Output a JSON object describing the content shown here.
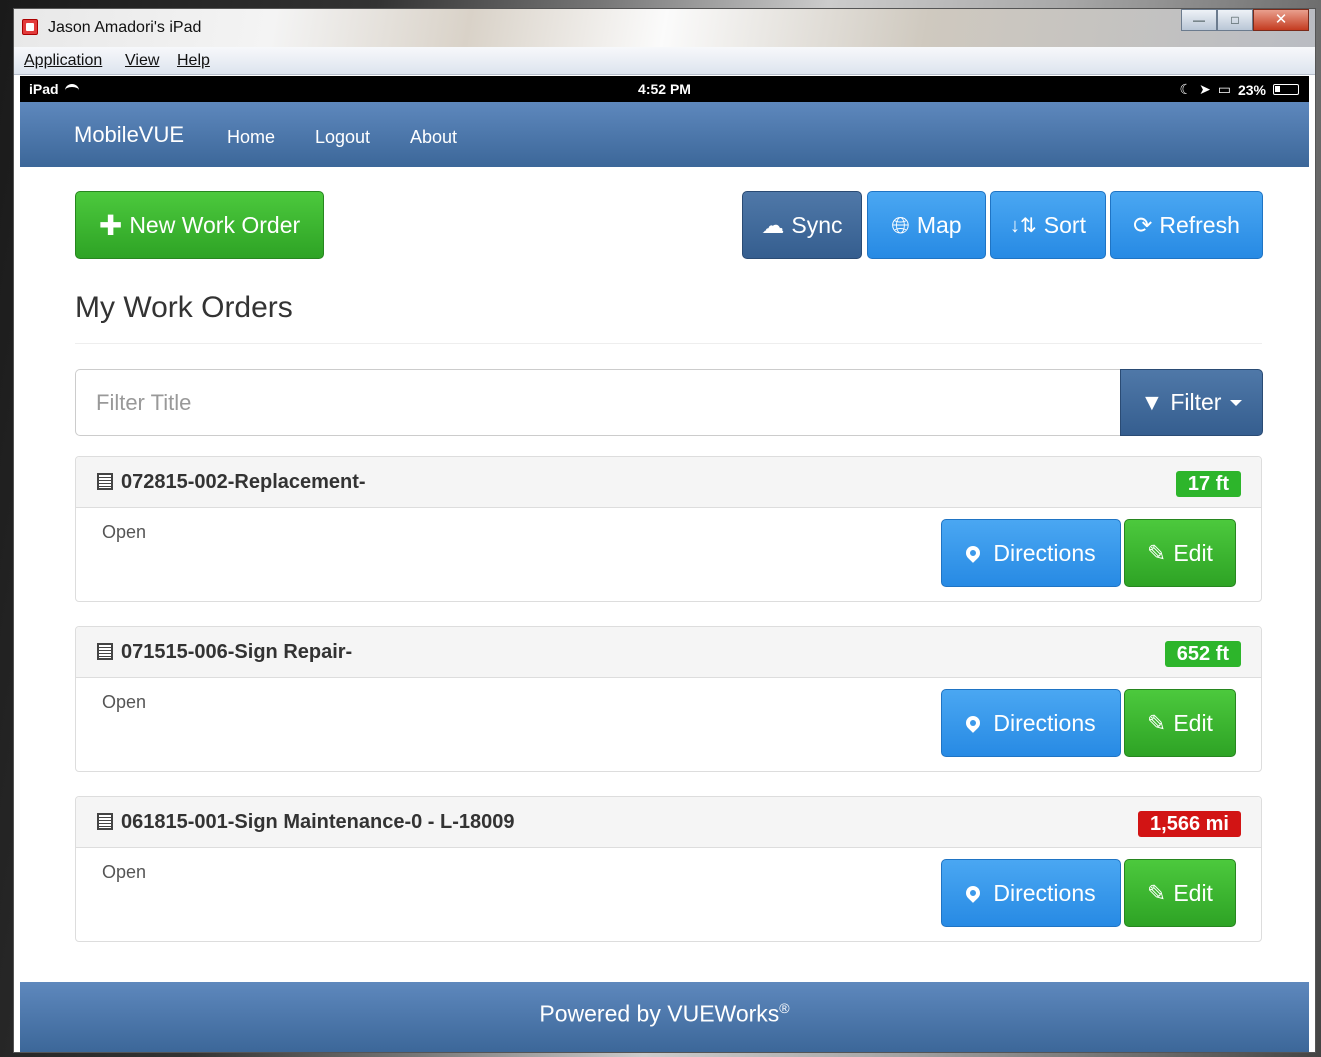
{
  "window": {
    "title": "Jason Amadori's iPad"
  },
  "menu": {
    "items": [
      "Application",
      "View",
      "Help"
    ]
  },
  "status_bar": {
    "device": "iPad",
    "time": "4:52 PM",
    "battery": "23%"
  },
  "nav": {
    "brand": "MobileVUE",
    "links": [
      "Home",
      "Logout",
      "About"
    ]
  },
  "toolbar": {
    "new_order": "New Work Order",
    "sync": "Sync",
    "map": "Map",
    "sort": "Sort",
    "refresh": "Refresh"
  },
  "page": {
    "title": "My Work Orders"
  },
  "filter": {
    "placeholder": "Filter Title",
    "value": "",
    "button": "Filter"
  },
  "work_orders": [
    {
      "title": "072815-002-Replacement-",
      "distance": "17 ft",
      "distance_color": "#2db52b",
      "status": "Open",
      "directions": "Directions",
      "edit": "Edit"
    },
    {
      "title": "071515-006-Sign Repair-",
      "distance": "652 ft",
      "distance_color": "#2db52b",
      "status": "Open",
      "directions": "Directions",
      "edit": "Edit"
    },
    {
      "title": "061815-001-Sign Maintenance-0 - L-18009",
      "distance": "1,566 mi",
      "distance_color": "#d21414",
      "status": "Open",
      "directions": "Directions",
      "edit": "Edit"
    }
  ],
  "footer": {
    "text": "Powered by VUEWorks",
    "mark": "®"
  }
}
